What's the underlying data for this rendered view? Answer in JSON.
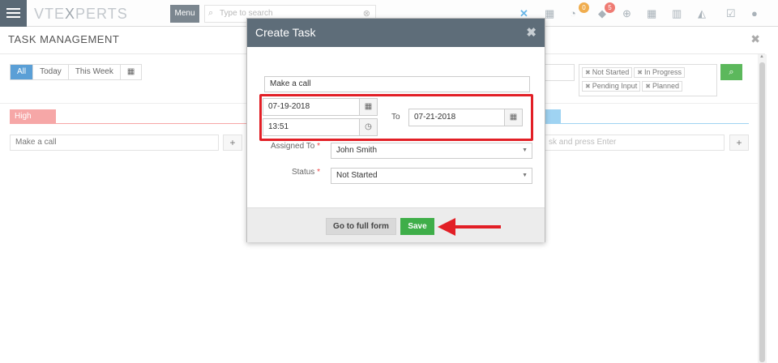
{
  "topbar": {
    "logo_main": "VTE",
    "logo_x": "X",
    "logo_end": "PERTS",
    "menu_label": "Menu",
    "search_placeholder": "Type to search",
    "badges": [
      "0",
      "5"
    ],
    "icons": [
      "vtexperts-x-icon",
      "calendar-icon",
      "chat-icon",
      "bell-icon",
      "plus-circle-icon",
      "calendar-grid-icon",
      "bar-chart-icon",
      "area-chart-icon",
      "checkbox-icon",
      "user-icon"
    ]
  },
  "page": {
    "title": "TASK MANAGEMENT",
    "filters": [
      "All",
      "Today",
      "This Week"
    ],
    "buckets": {
      "high_label": "High"
    },
    "quick_placeholder_left": "Make a call",
    "quick_placeholder_right": "sk and press Enter",
    "status_chips": [
      "Not Started",
      "In Progress",
      "Pending Input",
      "Planned"
    ]
  },
  "modal": {
    "title": "Create Task",
    "subject": "Make a call",
    "start_date": "07-19-2018",
    "start_time": "13:51",
    "to_label": "To",
    "end_date": "07-21-2018",
    "assigned_label": "Assigned To",
    "assigned_value": "John Smith",
    "status_label": "Status",
    "status_value": "Not Started",
    "full_form_label": "Go to full form",
    "save_label": "Save"
  },
  "colors": {
    "accent": "#5a9fd6",
    "header": "#5e6d79",
    "save": "#3fae49",
    "highlight": "#e21f26",
    "high_bucket": "#f6a7a7"
  }
}
